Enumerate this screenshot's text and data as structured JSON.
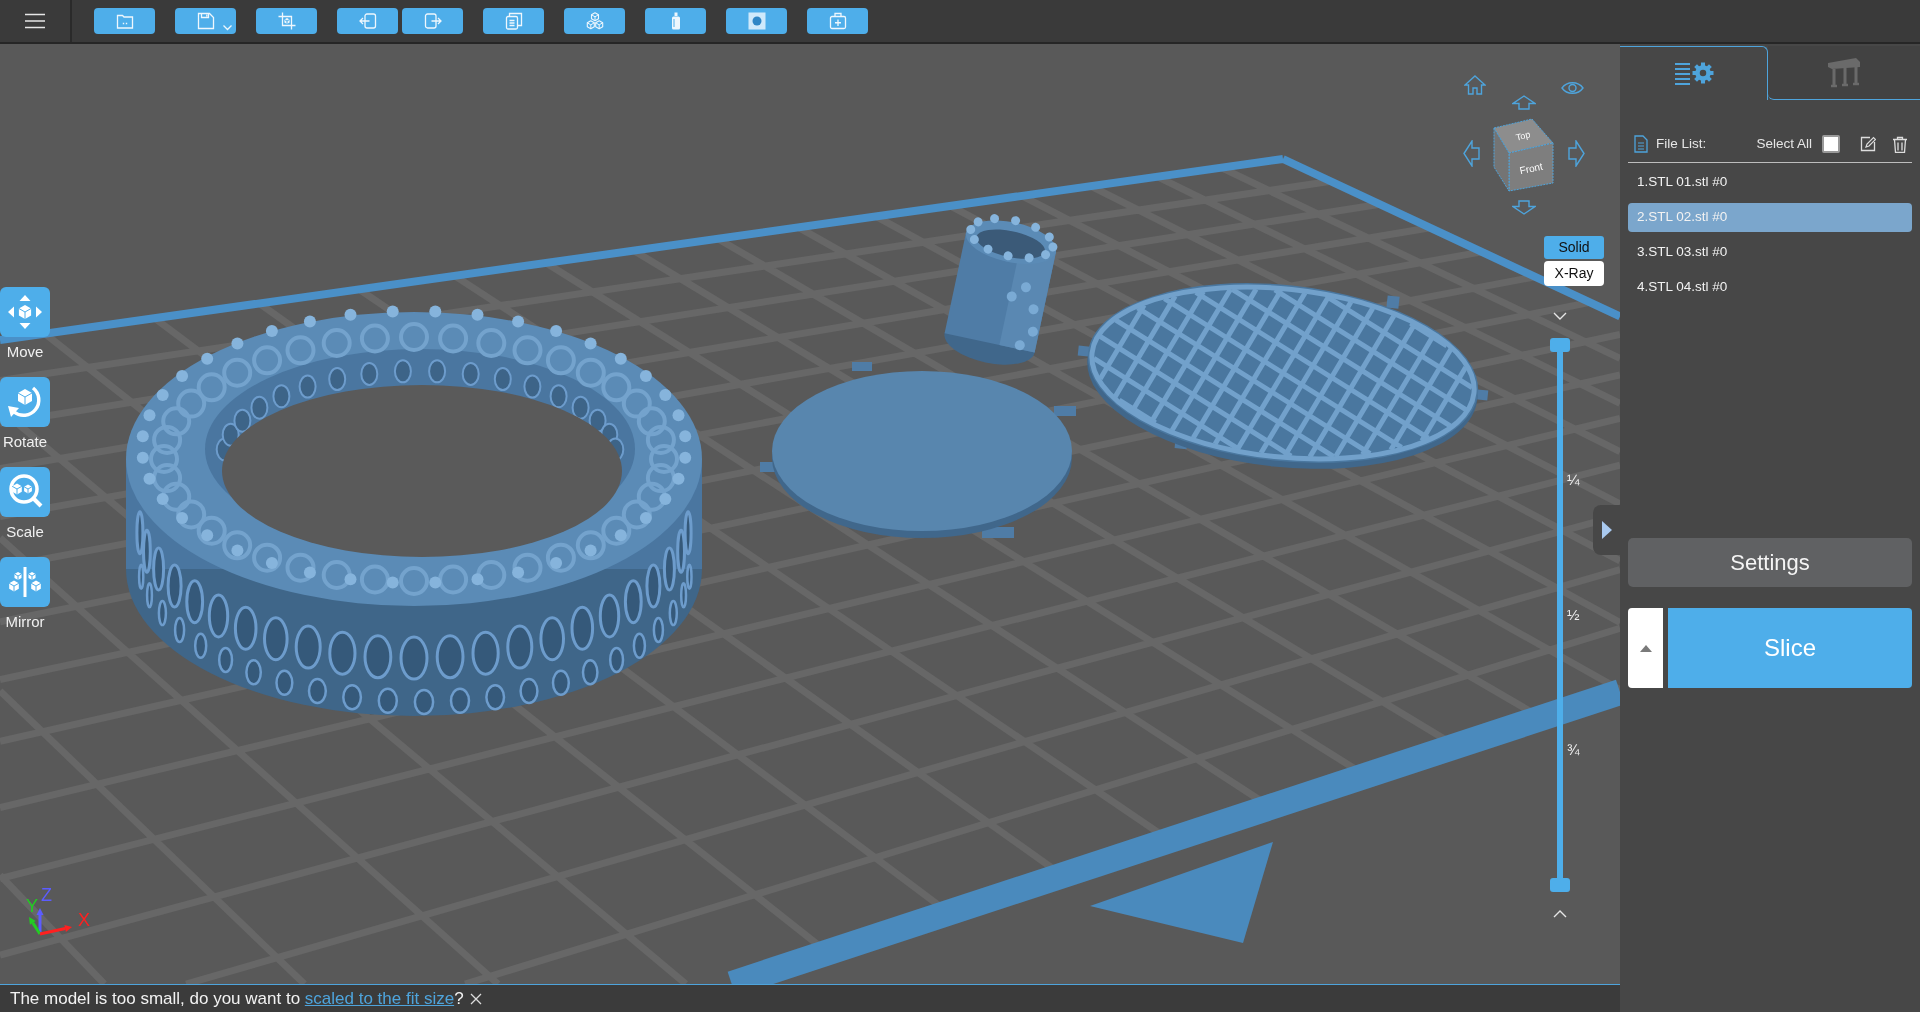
{
  "tools": [
    {
      "label": "Move"
    },
    {
      "label": "Rotate"
    },
    {
      "label": "Scale"
    },
    {
      "label": "Mirror"
    }
  ],
  "view_cube": {
    "faces": [
      "Top",
      "Front"
    ]
  },
  "render_modes": [
    {
      "label": "Solid",
      "selected": true
    },
    {
      "label": "X-Ray",
      "selected": false
    }
  ],
  "layer_slider": {
    "top_thumb": {
      "level": 1
    },
    "bottom_thumb": {
      "level": 0
    },
    "marks": [
      "¼",
      "½",
      "¾"
    ]
  },
  "axes": [
    {
      "label": "Z",
      "color": "#5c5cff"
    },
    {
      "label": "Y",
      "color": "#22cc22"
    },
    {
      "label": "X",
      "color": "#ff2020"
    }
  ],
  "panel": {
    "tabs": [
      {
        "selected": true
      },
      {
        "selected": false
      }
    ],
    "file_list": {
      "title": "File List:",
      "select_all": {
        "label": "Select All",
        "checked": false
      },
      "files": [
        {
          "label": "1.STL 01.stl #0",
          "selected": false
        },
        {
          "label": "2.STL 02.stl #0",
          "selected": true
        },
        {
          "label": "3.STL 03.stl #0",
          "selected": false
        },
        {
          "label": "4.STL 04.stl #0",
          "selected": false
        }
      ]
    },
    "settings_button": "Settings",
    "slice_button": "Slice"
  },
  "status_bar": {
    "message": "The model is too small, do you want to ",
    "link": "scaled to the fit size",
    "suffix": "?"
  }
}
